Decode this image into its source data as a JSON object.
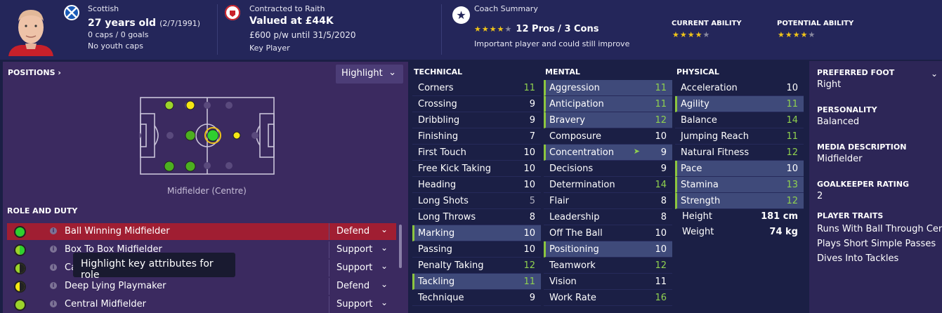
{
  "header": {
    "nation": "Scottish",
    "age": "27 years old",
    "dob": "(2/7/1991)",
    "caps": "0 caps / 0 goals",
    "youth": "No youth caps",
    "contract": "Contracted to Raith",
    "value": "Valued at £44K",
    "wage": "£600 p/w until 31/5/2020",
    "status": "Key Player",
    "coach_title": "Coach Summary",
    "pros_cons": "12 Pros / 3 Cons",
    "coach_text": "Important player and could still improve",
    "ca_label": "CURRENT ABILITY",
    "pa_label": "POTENTIAL ABILITY",
    "coach_stars": 3.5,
    "ca_stars": 3.5,
    "pa_stars": 3.5
  },
  "positions": {
    "title": "POSITIONS",
    "highlight": "Highlight",
    "role_label": "Midfielder (Centre)"
  },
  "roles": {
    "title": "ROLE AND DUTY",
    "items": [
      {
        "name": "Ball Winning Midfielder",
        "duty": "Defend"
      },
      {
        "name": "Box To Box Midfielder",
        "duty": "Support"
      },
      {
        "name": "Ca",
        "duty": "Support"
      },
      {
        "name": "Deep Lying Playmaker",
        "duty": "Defend"
      },
      {
        "name": "Central Midfielder",
        "duty": "Support"
      }
    ],
    "tooltip": "Highlight key attributes for role"
  },
  "technical": {
    "title": "TECHNICAL",
    "items": [
      {
        "n": "Corners",
        "v": "11"
      },
      {
        "n": "Crossing",
        "v": "9"
      },
      {
        "n": "Dribbling",
        "v": "9"
      },
      {
        "n": "Finishing",
        "v": "7"
      },
      {
        "n": "First Touch",
        "v": "10"
      },
      {
        "n": "Free Kick Taking",
        "v": "10"
      },
      {
        "n": "Heading",
        "v": "10"
      },
      {
        "n": "Long Shots",
        "v": "5"
      },
      {
        "n": "Long Throws",
        "v": "8"
      },
      {
        "n": "Marking",
        "v": "10"
      },
      {
        "n": "Passing",
        "v": "10"
      },
      {
        "n": "Penalty Taking",
        "v": "12"
      },
      {
        "n": "Tackling",
        "v": "11"
      },
      {
        "n": "Technique",
        "v": "9"
      }
    ]
  },
  "mental": {
    "title": "MENTAL",
    "items": [
      {
        "n": "Aggression",
        "v": "11"
      },
      {
        "n": "Anticipation",
        "v": "11"
      },
      {
        "n": "Bravery",
        "v": "12"
      },
      {
        "n": "Composure",
        "v": "10"
      },
      {
        "n": "Concentration",
        "v": "9"
      },
      {
        "n": "Decisions",
        "v": "9"
      },
      {
        "n": "Determination",
        "v": "14"
      },
      {
        "n": "Flair",
        "v": "8"
      },
      {
        "n": "Leadership",
        "v": "8"
      },
      {
        "n": "Off The Ball",
        "v": "10"
      },
      {
        "n": "Positioning",
        "v": "10"
      },
      {
        "n": "Teamwork",
        "v": "12"
      },
      {
        "n": "Vision",
        "v": "11"
      },
      {
        "n": "Work Rate",
        "v": "16"
      }
    ]
  },
  "physical": {
    "title": "PHYSICAL",
    "items": [
      {
        "n": "Acceleration",
        "v": "10"
      },
      {
        "n": "Agility",
        "v": "11"
      },
      {
        "n": "Balance",
        "v": "14"
      },
      {
        "n": "Jumping Reach",
        "v": "11"
      },
      {
        "n": "Natural Fitness",
        "v": "12"
      },
      {
        "n": "Pace",
        "v": "10"
      },
      {
        "n": "Stamina",
        "v": "13"
      },
      {
        "n": "Strength",
        "v": "12"
      }
    ],
    "height_label": "Height",
    "height": "181 cm",
    "weight_label": "Weight",
    "weight": "74 kg"
  },
  "info": {
    "foot_label": "PREFERRED FOOT",
    "foot": "Right",
    "pers_label": "PERSONALITY",
    "pers": "Balanced",
    "media_label": "MEDIA DESCRIPTION",
    "media": "Midfielder",
    "gk_label": "GOALKEEPER RATING",
    "gk": "2",
    "traits_label": "PLAYER TRAITS",
    "traits": [
      "Runs With Ball Through Centre",
      "Plays Short Simple Passes",
      "Dives Into Tackles"
    ]
  }
}
